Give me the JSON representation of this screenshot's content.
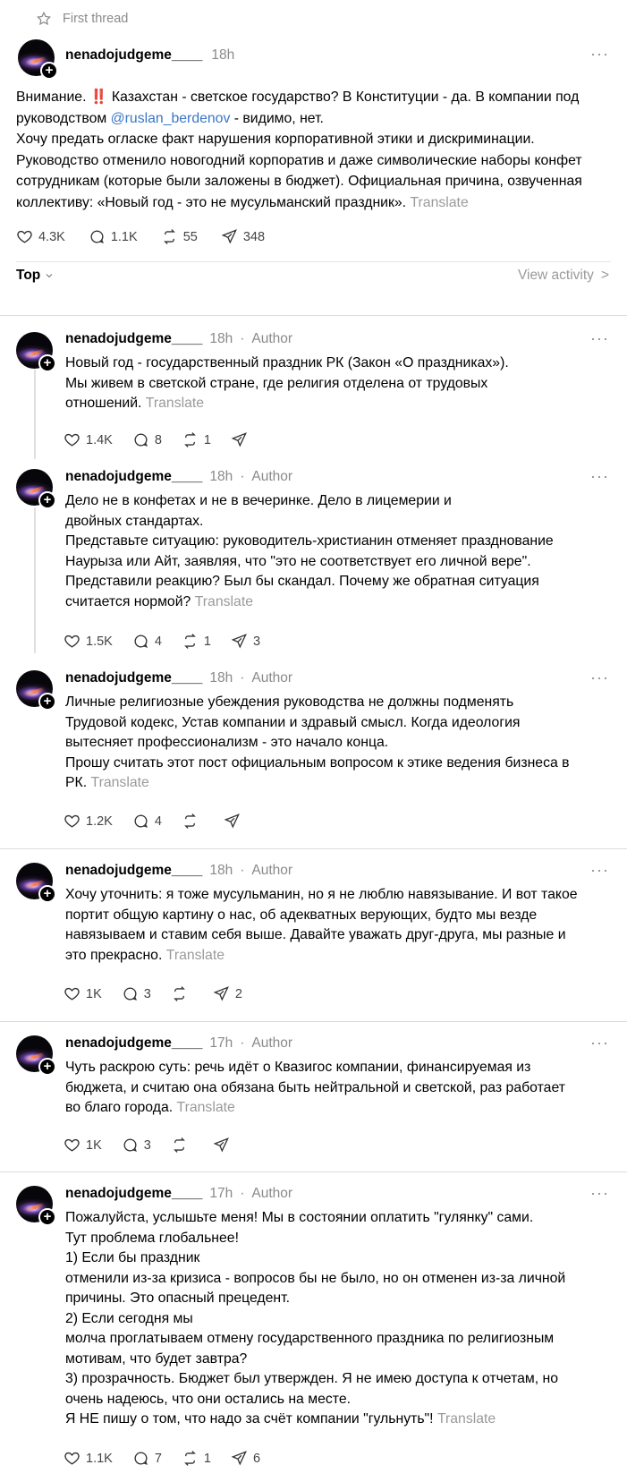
{
  "top_label": "First thread",
  "main_post": {
    "username": "nenadojudgeme____",
    "time": "18h",
    "text_1": "Внимание. ",
    "alert_glyph": "‼️",
    "text_2": " Казахстан - светское государство? В Конституции - да. В компании под руководством ",
    "mention": "@ruslan_berdenov",
    "text_3": " - видимо, нет.",
    "text_4": "Хочу предать огласке факт нарушения корпоративной этики и дискриминации. Руководство отменило новогодний корпоратив и даже символические наборы конфет сотрудникам (которые были заложены в бюджет). Официальная причина, озвученная коллективу: «Новый год - это не мусульманский праздник».",
    "translate": "Translate",
    "likes": "4.3K",
    "comments": "1.1K",
    "reposts": "55",
    "shares": "348"
  },
  "sort": {
    "label": "Top",
    "view_activity": "View activity",
    "chevron": ">"
  },
  "replies": [
    {
      "username": "nenadojudgeme____",
      "time": "18h",
      "author": "Author",
      "lines": [
        "Новый год - государственный праздник РК (Закон «О праздниках»).",
        "Мы живем в светской стране, где религия отделена от трудовых",
        "отношений."
      ],
      "translate": "Translate",
      "likes": "1.4K",
      "comments": "8",
      "reposts": "1",
      "shares": ""
    },
    {
      "username": "nenadojudgeme____",
      "time": "18h",
      "author": "Author",
      "lines": [
        "Дело не в конфетах и не в вечеринке. Дело в лицемерии и",
        "двойных стандартах.",
        "Представьте ситуацию: руководитель-христианин отменяет празднование",
        "Наурыза или Айт, заявляя, что \"это не соответствует его личной вере\".",
        "Представили реакцию? Был бы скандал. Почему же обратная ситуация",
        "считается нормой?"
      ],
      "translate": "Translate",
      "likes": "1.5K",
      "comments": "4",
      "reposts": "1",
      "shares": "3"
    },
    {
      "username": "nenadojudgeme____",
      "time": "18h",
      "author": "Author",
      "lines": [
        "Личные религиозные убеждения руководства не должны подменять",
        "Трудовой кодекс, Устав компании и здравый смысл. Когда идеология",
        "вытесняет профессионализм - это начало конца.",
        "Прошу считать этот пост официальным вопросом к этике ведения бизнеса в",
        "РК."
      ],
      "translate": "Translate",
      "likes": "1.2K",
      "comments": "4",
      "reposts": "",
      "shares": ""
    },
    {
      "username": "nenadojudgeme____",
      "time": "18h",
      "author": "Author",
      "lines": [
        "Хочу уточнить: я тоже мусульманин, но я не люблю навязывание. И вот такое",
        "портит общую картину о нас, об адекватных верующих, будто мы везде",
        "навязываем и ставим себя выше. Давайте уважать друг-друга, мы разные и",
        "это прекрасно."
      ],
      "translate": "Translate",
      "likes": "1K",
      "comments": "3",
      "reposts": "",
      "shares": "2"
    },
    {
      "username": "nenadojudgeme____",
      "time": "17h",
      "author": "Author",
      "lines": [
        "Чуть раскрою суть: речь идёт о Квазигос компании, финансируемая из",
        "бюджета, и считаю она обязана быть нейтральной и светской, раз работает",
        "во благо города."
      ],
      "translate": "Translate",
      "likes": "1K",
      "comments": "3",
      "reposts": "",
      "shares": ""
    },
    {
      "username": "nenadojudgeme____",
      "time": "17h",
      "author": "Author",
      "lines": [
        "Пожалуйста, услышьте меня! Мы в состоянии оплатить \"гулянку\" сами.",
        "Тут проблема глобальнее!",
        "1) Если бы праздник",
        "отменили из-за кризиса - вопросов бы не было, но он отменен из-за личной",
        "причины. Это опасный прецедент.",
        "2) Если сегодня мы",
        "молча проглатываем отмену государственного праздника по религиозным",
        "мотивам, что будет завтра?",
        "3) прозрачность. Бюджет был утвержден. Я не имею доступа к отчетам, но",
        "очень надеюсь, что они остались на месте.",
        "Я НЕ пишу о том, что надо за счёт компании \"гульнуть\"!"
      ],
      "translate": "Translate",
      "likes": "1.1K",
      "comments": "7",
      "reposts": "1",
      "shares": "6"
    }
  ],
  "more_glyph": "···",
  "dot_glyph": "·"
}
